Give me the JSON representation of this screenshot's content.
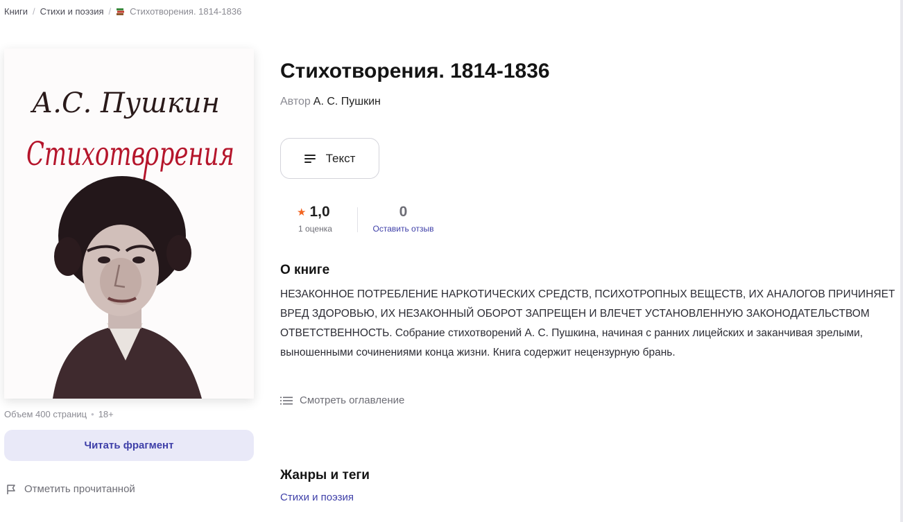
{
  "breadcrumb": {
    "items": [
      "Книги",
      "Стихи и поэзия"
    ],
    "separator": "/",
    "current": "Стихотворения. 1814-1836"
  },
  "cover": {
    "author_script": "А.С. Пушкин",
    "title_script": "Стихотворения"
  },
  "book": {
    "title": "Стихотворения. 1814-1836",
    "author_prefix": "Автор",
    "author_name": "А. С. Пушкин",
    "volume": "Объем 400 страниц",
    "age_rating": "18+"
  },
  "format_button": {
    "label": "Текст",
    "icon": "text-lines-icon"
  },
  "rating": {
    "star_icon": "★",
    "value": "1,0",
    "count_label": "1 оценка",
    "reviews_count": "0",
    "reviews_link": "Оставить отзыв"
  },
  "about": {
    "heading": "О книге",
    "text": "НЕЗАКОННОЕ ПОТРЕБЛЕНИЕ НАРКОТИЧЕСКИХ СРЕДСТВ, ПСИХОТРОПНЫХ ВЕЩЕСТВ, ИХ АНАЛОГОВ ПРИЧИНЯЕТ ВРЕД ЗДОРОВЬЮ, ИХ НЕЗАКОННЫЙ ОБОРОТ ЗАПРЕЩЕН И ВЛЕЧЕТ УСТАНОВЛЕННУЮ ЗАКОНОДАТЕЛЬСТВОМ ОТВЕТСТВЕННОСТЬ. Собрание стихотворений А. С. Пушкина, начиная с ранних лицейских и заканчивая зрелыми, выношенными сочинениями конца жизни. Книга содержит нецензурную брань.",
    "toc_link": "Смотреть оглавление"
  },
  "actions": {
    "read_fragment": "Читать фрагмент",
    "mark_read": "Отметить прочитанной"
  },
  "genres": {
    "heading": "Жанры и теги",
    "tags": [
      "Стихи и поэзия"
    ]
  },
  "colors": {
    "accent": "#3e3fa8",
    "star": "#f26522",
    "button_bg": "#e9e9f8",
    "cover_title_red": "#b5152b"
  }
}
